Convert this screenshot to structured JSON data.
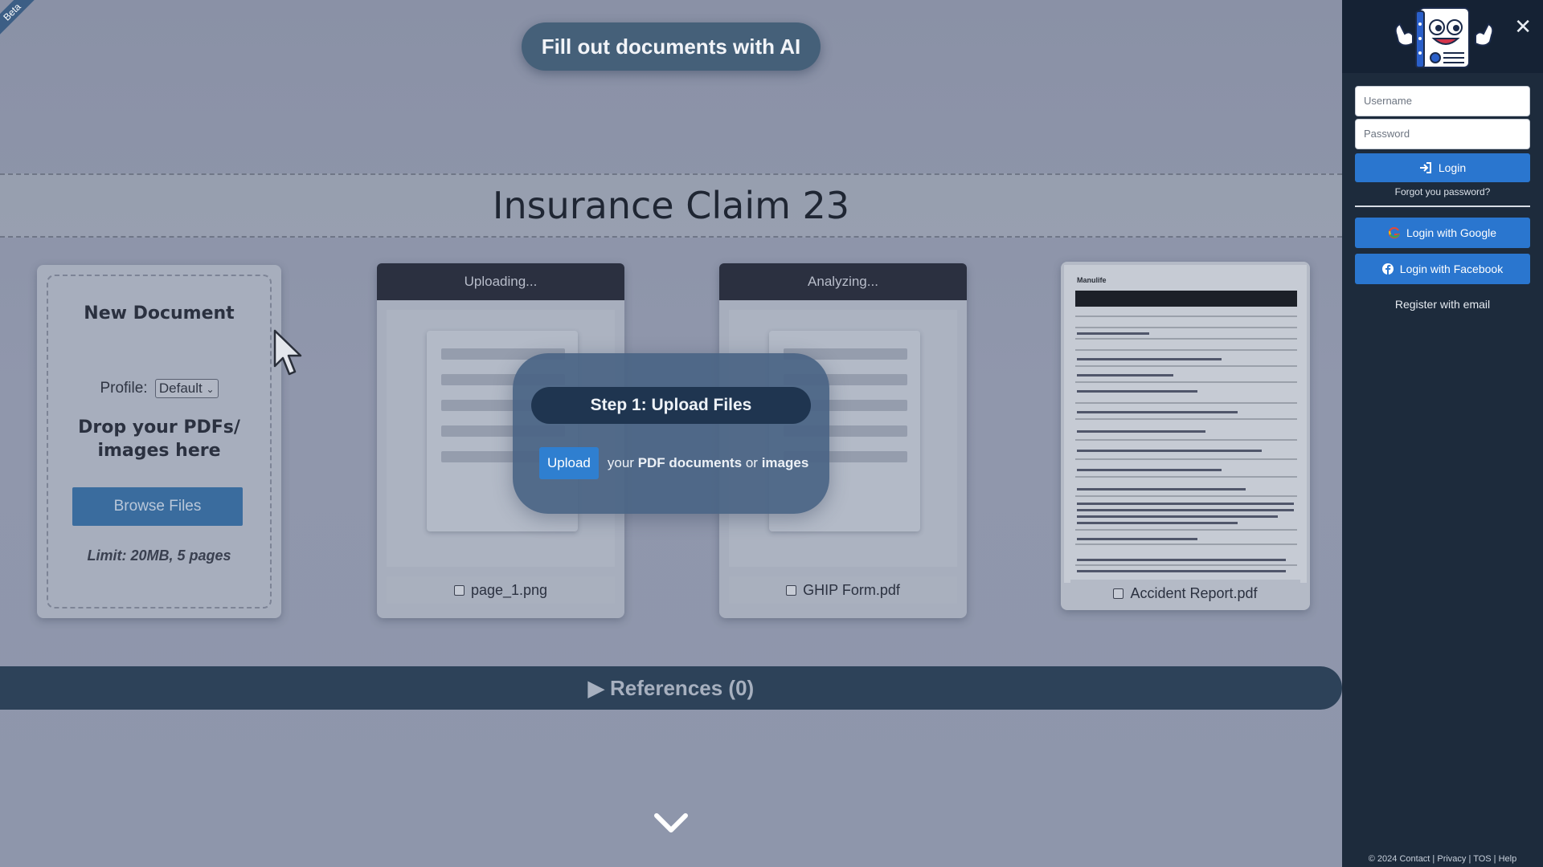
{
  "beta": "Beta",
  "hero": {
    "title": "Fill out documents with AI"
  },
  "claim": {
    "title": "Insurance Claim 23"
  },
  "new_document": {
    "title": "New Document",
    "profile_label": "Profile:",
    "profile_value": "Default",
    "drop_text_line1": "Drop your PDFs/",
    "drop_text_line2": "images here",
    "browse_label": "Browse Files",
    "limit": "Limit: 20MB, 5 pages"
  },
  "documents": [
    {
      "status": "Uploading...",
      "filename": "page_1.png"
    },
    {
      "status": "Analyzing...",
      "filename": "GHIP Form.pdf"
    },
    {
      "status": "",
      "filename": "Accident Report.pdf"
    }
  ],
  "step": {
    "title": "Step 1: Upload Files",
    "upload_label": "Upload",
    "text_your": "your",
    "text_pdf": "PDF documents",
    "text_or": "or",
    "text_images": "images"
  },
  "references": {
    "label": "▶ References (0)"
  },
  "sidebar": {
    "username_placeholder": "Username",
    "password_placeholder": "Password",
    "login_label": "Login",
    "forgot_label": "Forgot you password?",
    "google_label": "Login with Google",
    "facebook_label": "Login with Facebook",
    "register_label": "Register with email",
    "footer": {
      "copyright": "© 2024",
      "links": [
        "Contact",
        "Privacy",
        "TOS",
        "Help"
      ]
    }
  },
  "report_preview": {
    "brand": "Manulife"
  }
}
